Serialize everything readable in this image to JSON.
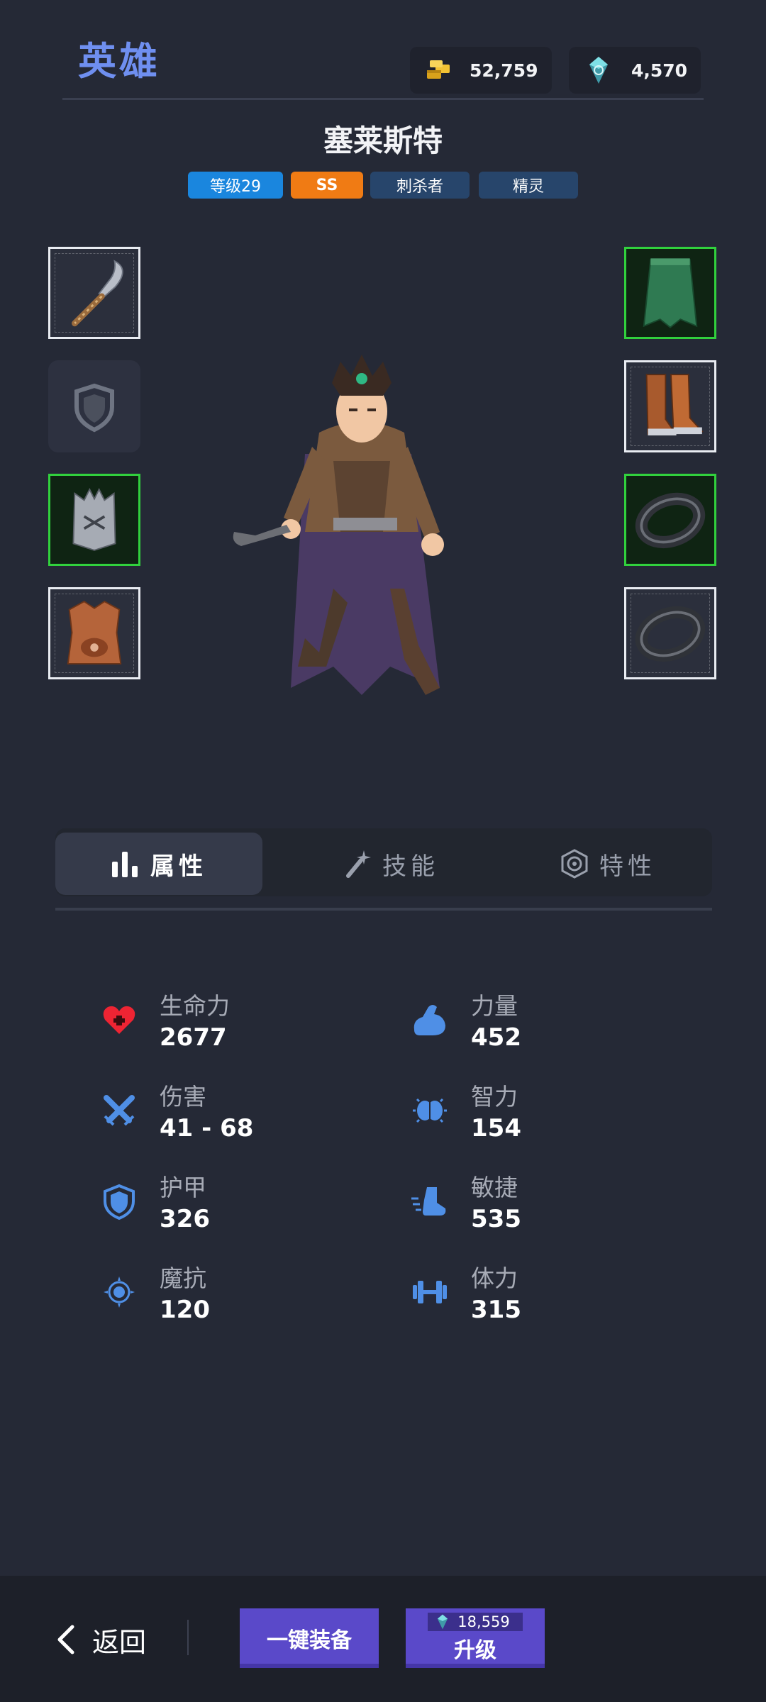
{
  "header": {
    "title": "英雄",
    "gold": {
      "icon": "gold-bars-icon",
      "value": "52,759"
    },
    "gems": {
      "icon": "crystal-icon",
      "value": "4,570"
    }
  },
  "hero": {
    "name": "塞莱斯特",
    "tags": [
      "等级29",
      "SS",
      "刺杀者",
      "精灵"
    ]
  },
  "equipment": {
    "left": [
      "weapon-sickle-icon",
      "shield-slot-empty-icon",
      "helmet-icon",
      "chest-armor-icon"
    ],
    "right": [
      "cloak-icon",
      "boots-icon",
      "ring-icon",
      "ring-icon"
    ]
  },
  "tabs": [
    {
      "label": "属性",
      "icon": "bar-chart-icon",
      "active": true
    },
    {
      "label": "技能",
      "icon": "magic-wand-icon",
      "active": false
    },
    {
      "label": "特性",
      "icon": "trait-badge-icon",
      "active": false
    }
  ],
  "stats": {
    "left": [
      {
        "label": "生命力",
        "value": "2677",
        "icon": "heart-plus-icon"
      },
      {
        "label": "伤害",
        "value": "41 - 68",
        "icon": "crossed-swords-icon"
      },
      {
        "label": "护甲",
        "value": "326",
        "icon": "shield-icon"
      },
      {
        "label": "魔抗",
        "value": "120",
        "icon": "magic-resist-icon"
      }
    ],
    "right": [
      {
        "label": "力量",
        "value": "452",
        "icon": "flexed-arm-icon"
      },
      {
        "label": "智力",
        "value": "154",
        "icon": "brain-icon"
      },
      {
        "label": "敏捷",
        "value": "535",
        "icon": "boot-dash-icon"
      },
      {
        "label": "体力",
        "value": "315",
        "icon": "dumbbell-icon"
      }
    ]
  },
  "bottom": {
    "back_label": "返回",
    "auto_equip_label": "一键装备",
    "upgrade_cost": "18,559",
    "upgrade_label": "升级"
  },
  "colors": {
    "accent_title": "#6f8ff0",
    "level_tag": "#1a86de",
    "rank_tag": "#f07b14",
    "tag_dark": "#27456b",
    "button": "#5a49c9",
    "stat_icon": "#4f8fe6",
    "health_icon": "#ee2433",
    "equip_rare": "#31d13d"
  }
}
